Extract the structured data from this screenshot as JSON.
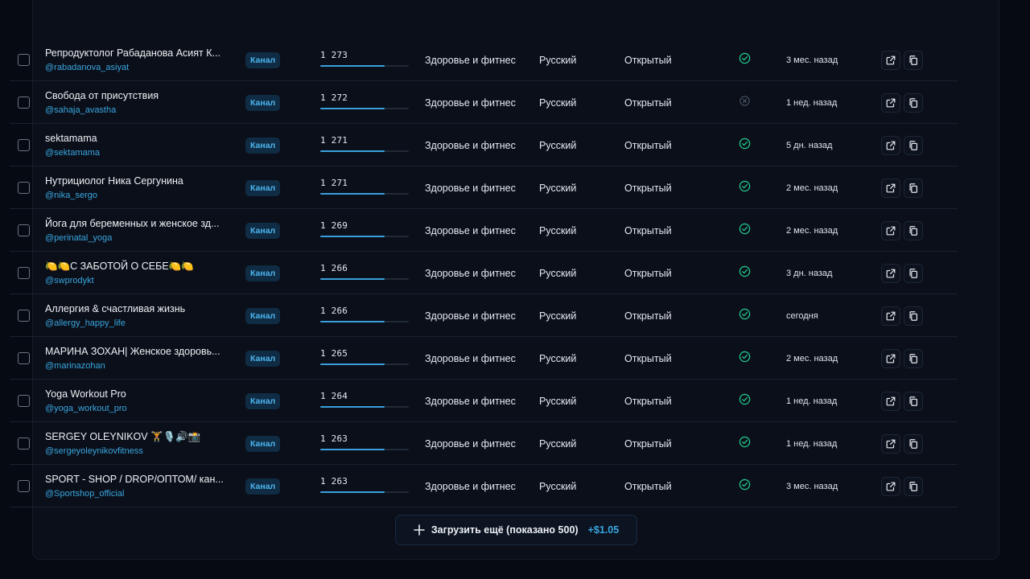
{
  "colors": {
    "accent": "#3aa6e0",
    "verified": "#22c58b",
    "unverified": "#4a5465"
  },
  "rows": [
    {
      "name": "Репродуктолог Рабаданова Асият К...",
      "handle": "@rabadanova_asiyat",
      "badge": "Канал",
      "subscribers": "1 273",
      "fill": 0.73,
      "category": "Здоровье и фитнес",
      "language": "Русский",
      "access": "Открытый",
      "verified": true,
      "updated": "3 мес. назад"
    },
    {
      "name": "Свобода от присутствия",
      "handle": "@sahaja_avastha",
      "badge": "Канал",
      "subscribers": "1 272",
      "fill": 0.73,
      "category": "Здоровье и фитнес",
      "language": "Русский",
      "access": "Открытый",
      "verified": false,
      "updated": "1 нед. назад"
    },
    {
      "name": "sektamama",
      "handle": "@sektamama",
      "badge": "Канал",
      "subscribers": "1 271",
      "fill": 0.73,
      "category": "Здоровье и фитнес",
      "language": "Русский",
      "access": "Открытый",
      "verified": true,
      "updated": "5 дн. назад"
    },
    {
      "name": "Нутрициолог Ника Сергунина",
      "handle": "@nika_sergo",
      "badge": "Канал",
      "subscribers": "1 271",
      "fill": 0.73,
      "category": "Здоровье и фитнес",
      "language": "Русский",
      "access": "Открытый",
      "verified": true,
      "updated": "2 мес. назад"
    },
    {
      "name": "Йога для беременных и женское зд...",
      "handle": "@perinatal_yoga",
      "badge": "Канал",
      "subscribers": "1 269",
      "fill": 0.73,
      "category": "Здоровье и фитнес",
      "language": "Русский",
      "access": "Открытый",
      "verified": true,
      "updated": "2 мес. назад"
    },
    {
      "name": "🍋🍋С ЗАБОТОЙ О СЕБЕ🍋🍋",
      "handle": "@swprodykt",
      "badge": "Канал",
      "subscribers": "1 266",
      "fill": 0.73,
      "category": "Здоровье и фитнес",
      "language": "Русский",
      "access": "Открытый",
      "verified": true,
      "updated": "3 дн. назад"
    },
    {
      "name": "Аллергия & счастливая жизнь",
      "handle": "@allergy_happy_life",
      "badge": "Канал",
      "subscribers": "1 266",
      "fill": 0.73,
      "category": "Здоровье и фитнес",
      "language": "Русский",
      "access": "Открытый",
      "verified": true,
      "updated": "сегодня"
    },
    {
      "name": "МАРИНА ЗОХАН| Женское здоровь...",
      "handle": "@marinazohan",
      "badge": "Канал",
      "subscribers": "1 265",
      "fill": 0.73,
      "category": "Здоровье и фитнес",
      "language": "Русский",
      "access": "Открытый",
      "verified": true,
      "updated": "2 мес. назад"
    },
    {
      "name": "Yoga Workout Pro",
      "handle": "@yoga_workout_pro",
      "badge": "Канал",
      "subscribers": "1 264",
      "fill": 0.73,
      "category": "Здоровье и фитнес",
      "language": "Русский",
      "access": "Открытый",
      "verified": true,
      "updated": "1 нед. назад"
    },
    {
      "name": "SERGEY OLEYNIKOV 🏋️🎙️🔊📸",
      "handle": "@sergeyoleynikovfitness",
      "badge": "Канал",
      "subscribers": "1 263",
      "fill": 0.73,
      "category": "Здоровье и фитнес",
      "language": "Русский",
      "access": "Открытый",
      "verified": true,
      "updated": "1 нед. назад"
    },
    {
      "name": "SPORT - SHOP / DROP/ОПТОМ/ кан...",
      "handle": "@Sportshop_official",
      "badge": "Канал",
      "subscribers": "1 263",
      "fill": 0.73,
      "category": "Здоровье и фитнес",
      "language": "Русский",
      "access": "Открытый",
      "verified": true,
      "updated": "3 мес. назад"
    }
  ],
  "icons": {
    "open": "external-link-icon",
    "copy": "copy-icon",
    "verified": "check-circle-icon",
    "unverified": "x-circle-icon",
    "load_more": "plus-icon"
  },
  "load_more": {
    "label": "Загрузить ещё (показано 500)",
    "price": "+$1.05"
  }
}
